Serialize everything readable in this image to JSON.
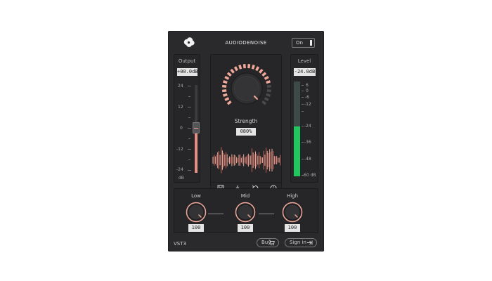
{
  "header": {
    "title": "AUDIODENOISE",
    "logo_icon": "cloud-logo-icon",
    "power_toggle": {
      "label": "On",
      "state": "on"
    }
  },
  "output": {
    "label": "Output",
    "value": "+00.0dB",
    "ticks": [
      "24",
      "12",
      "0",
      "-12",
      "-24"
    ],
    "unit": "dB",
    "fader_level_db": 0
  },
  "strength": {
    "label": "Strength",
    "value": "080%",
    "fraction": 0.8
  },
  "transport": {
    "icons": [
      "save-icon",
      "download-icon",
      "reset-icon",
      "info-icon"
    ]
  },
  "level": {
    "label": "Level",
    "value": "-24.0dB",
    "ticks": [
      "6",
      "0",
      "-6",
      "-12",
      "-24",
      "-36",
      "-48",
      "-60 dB"
    ],
    "meter_db": -24
  },
  "bands": [
    {
      "label": "Low",
      "value": "100"
    },
    {
      "label": "Mid",
      "value": "100"
    },
    {
      "label": "High",
      "value": "100"
    }
  ],
  "footer": {
    "format": "VST3",
    "buy_label": "Buy",
    "signin_label": "Sign in"
  },
  "colors": {
    "accent": "#f0a89a",
    "accent_dark": "#c46a5e",
    "meter_green": "#22c55e",
    "background": "#2a2a2c"
  }
}
